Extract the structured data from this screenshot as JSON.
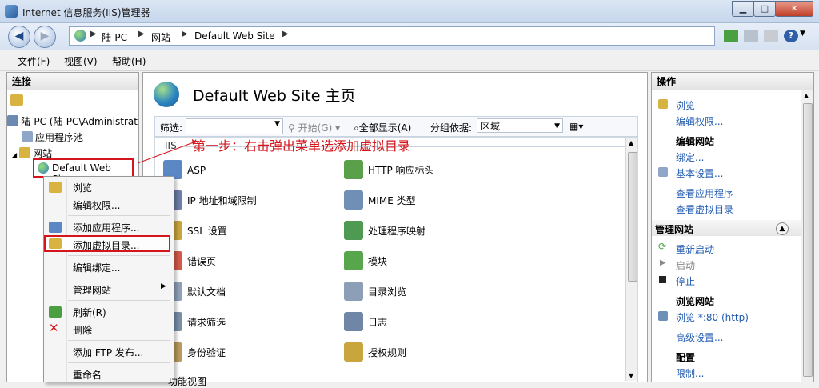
{
  "window": {
    "title": "Internet 信息服务(IIS)管理器"
  },
  "address": {
    "crumbs": [
      "陆-PC",
      "网站",
      "Default Web Site"
    ]
  },
  "menu": {
    "items": [
      "文件(F)",
      "视图(V)",
      "帮助(H)"
    ]
  },
  "connections": {
    "header": "连接",
    "tree": [
      "陆-PC (陆-PC\\Administrat",
      "应用程序池",
      "网站",
      "Default Web Site"
    ]
  },
  "main": {
    "title": "Default Web Site 主页",
    "filter_label": "筛选:",
    "start_label": "开始(G)",
    "show_all_label": "全部显示(A)",
    "groupby_label": "分组依据:",
    "groupby_value": "区域",
    "section_label": "IIS",
    "features_left": [
      "ASP",
      "IP 地址和域限制",
      "SSL 设置",
      "错误页",
      "默认文档",
      "请求筛选",
      "身份验证"
    ],
    "features_right": [
      "HTTP 响应标头",
      "MIME 类型",
      "处理程序映射",
      "模块",
      "目录浏览",
      "日志",
      "授权规则"
    ],
    "bottom_tabs": "功能视图"
  },
  "annotation": "第一步：右击弹出菜单选添加虚拟目录",
  "context_menu": {
    "items": [
      "浏览",
      "编辑权限...",
      "添加应用程序...",
      "添加虚拟目录...",
      "编辑绑定...",
      "管理网站",
      "刷新(R)",
      "删除",
      "添加 FTP 发布...",
      "重命名"
    ]
  },
  "actions": {
    "header": "操作",
    "browse": "浏览",
    "edit_permissions": "编辑权限...",
    "edit_site": "编辑网站",
    "bindings": "绑定...",
    "basic_settings": "基本设置...",
    "view_apps": "查看应用程序",
    "view_vdirs": "查看虚拟目录",
    "manage_site": "管理网站",
    "restart": "重新启动",
    "start": "启动",
    "stop": "停止",
    "browse_site": "浏览网站",
    "browse_http": "浏览 *:80 (http)",
    "advanced": "高级设置...",
    "configure": "配置",
    "limits": "限制..."
  },
  "colors": {
    "accent_red": "#d4161c",
    "link_blue": "#1f5ab0"
  }
}
